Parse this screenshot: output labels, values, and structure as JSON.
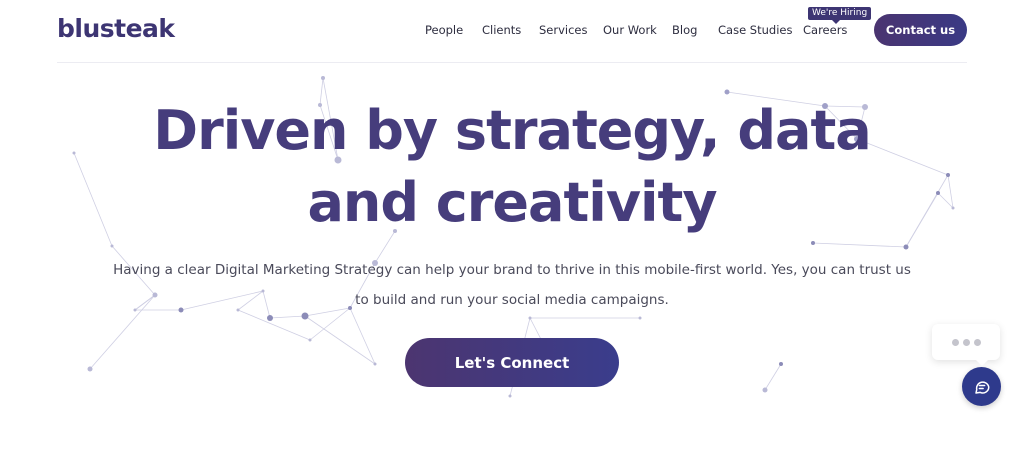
{
  "brand": {
    "logo_text": "blusteak",
    "primary_color": "#3d3573",
    "accent_color": "#2e3a8c"
  },
  "nav": {
    "items": [
      {
        "label": "People"
      },
      {
        "label": "Clients"
      },
      {
        "label": "Services"
      },
      {
        "label": "Our Work"
      },
      {
        "label": "Blog"
      },
      {
        "label": "Case Studies"
      },
      {
        "label": "Careers"
      }
    ],
    "hiring_badge": "We're Hiring",
    "contact_label": "Contact us"
  },
  "hero": {
    "title_line1": "Driven by strategy, data",
    "title_line2": "and creativity",
    "subtitle": "Having a clear Digital Marketing Strategy can help your brand to thrive in this mobile-first world. Yes, you can trust us to build and run your social media campaigns.",
    "cta_label": "Let's Connect"
  },
  "chat": {
    "launcher_icon": "chat-bubble-icon"
  }
}
